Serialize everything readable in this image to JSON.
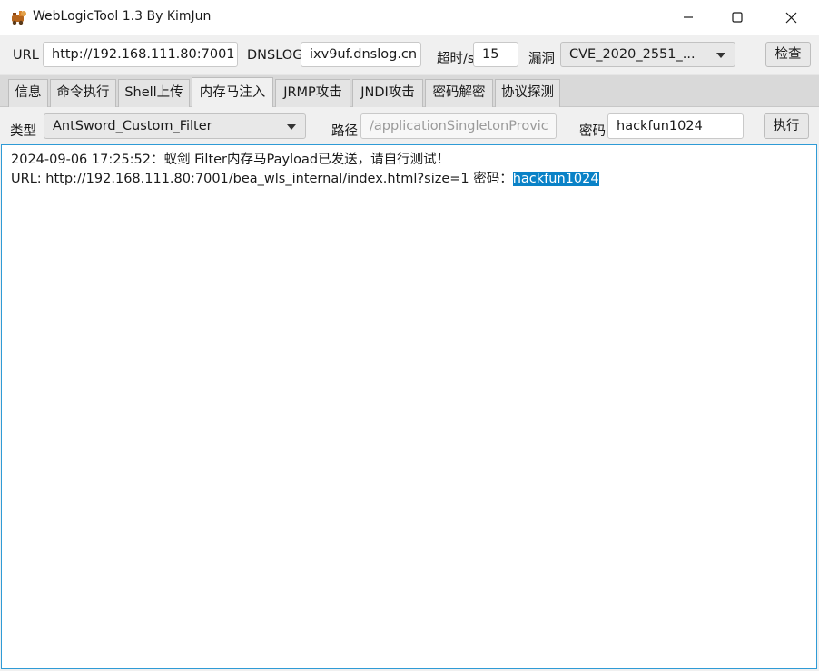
{
  "window": {
    "title": "WebLogicTool 1.3 By KimJun"
  },
  "toolbar": {
    "url_label": "URL",
    "url_value": "http://192.168.111.80:7001",
    "dnslog_label": "DNSLOG",
    "dnslog_value": "ixv9uf.dnslog.cn",
    "timeout_label": "超时/s",
    "timeout_value": "15",
    "vuln_label": "漏洞",
    "vuln_value": "CVE_2020_2551_...",
    "check_button": "检查"
  },
  "tabs": [
    {
      "label": "信息"
    },
    {
      "label": "命令执行"
    },
    {
      "label": "Shell上传"
    },
    {
      "label": "内存马注入",
      "active": true
    },
    {
      "label": "JRMP攻击"
    },
    {
      "label": "JNDI攻击"
    },
    {
      "label": "密码解密"
    },
    {
      "label": "协议探测"
    }
  ],
  "memshell": {
    "type_label": "类型",
    "type_value": "AntSword_Custom_Filter",
    "path_label": "路径",
    "path_placeholder": "/applicationSingletonProvic",
    "password_label": "密码",
    "password_value": "hackfun1024",
    "execute_button": "执行"
  },
  "output": {
    "line1": "2024-09-06 17:25:52：蚁剑 Filter内存马Payload已发送，请自行测试！",
    "line2_prefix": "URL: http://192.168.111.80:7001/bea_wls_internal/index.html?size=1   密码：",
    "line2_highlight": "hackfun1024"
  },
  "colors": {
    "highlight_bg": "#0a82c7",
    "output_border": "#2f9bd6"
  }
}
